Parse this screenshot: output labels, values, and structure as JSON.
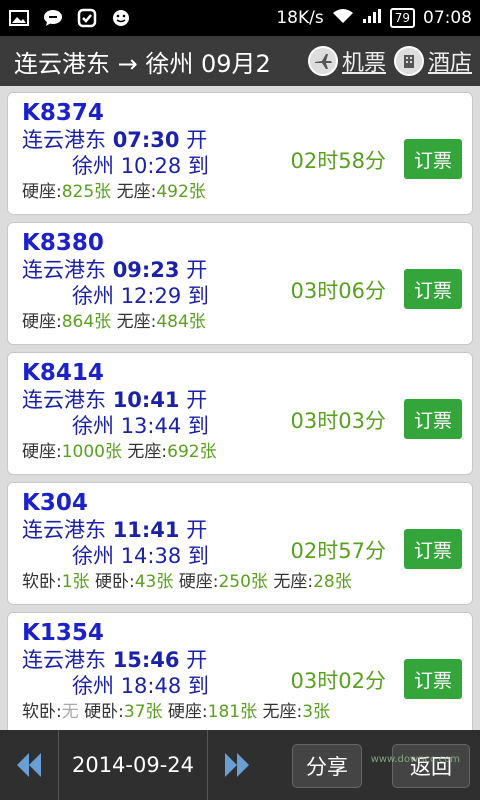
{
  "status_bar": {
    "speed": "18K/s",
    "battery": "79",
    "time": "07:08",
    "icons": [
      "image-icon",
      "chat-icon",
      "scan-icon",
      "smiley-icon",
      "wifi-icon",
      "signal-icon",
      "battery-icon"
    ]
  },
  "header": {
    "route": "连云港东 → 徐州 09月2",
    "flight_label": "机票",
    "hotel_label": "酒店"
  },
  "trains": [
    {
      "number": "K8374",
      "from_station": "连云港东",
      "depart_time": "07:30",
      "depart_suffix": "开",
      "to_station": "徐州",
      "arrive_time": "10:28",
      "arrive_suffix": "到",
      "duration": "02时58分",
      "book_label": "订票",
      "seats": [
        {
          "type": "硬座:",
          "count": "825张"
        },
        {
          "type": "无座:",
          "count": "492张"
        }
      ]
    },
    {
      "number": "K8380",
      "from_station": "连云港东",
      "depart_time": "09:23",
      "depart_suffix": "开",
      "to_station": "徐州",
      "arrive_time": "12:29",
      "arrive_suffix": "到",
      "duration": "03时06分",
      "book_label": "订票",
      "seats": [
        {
          "type": "硬座:",
          "count": "864张"
        },
        {
          "type": "无座:",
          "count": "484张"
        }
      ]
    },
    {
      "number": "K8414",
      "from_station": "连云港东",
      "depart_time": "10:41",
      "depart_suffix": "开",
      "to_station": "徐州",
      "arrive_time": "13:44",
      "arrive_suffix": "到",
      "duration": "03时03分",
      "book_label": "订票",
      "seats": [
        {
          "type": "硬座:",
          "count": "1000张"
        },
        {
          "type": "无座:",
          "count": "692张"
        }
      ]
    },
    {
      "number": "K304",
      "from_station": "连云港东",
      "depart_time": "11:41",
      "depart_suffix": "开",
      "to_station": "徐州",
      "arrive_time": "14:38",
      "arrive_suffix": "到",
      "duration": "02时57分",
      "book_label": "订票",
      "seats": [
        {
          "type": "软卧:",
          "count": "1张"
        },
        {
          "type": "硬卧:",
          "count": "43张"
        },
        {
          "type": "硬座:",
          "count": "250张"
        },
        {
          "type": "无座:",
          "count": "28张"
        }
      ]
    },
    {
      "number": "K1354",
      "from_station": "连云港东",
      "depart_time": "15:46",
      "depart_suffix": "开",
      "to_station": "徐州",
      "arrive_time": "18:48",
      "arrive_suffix": "到",
      "duration": "03时02分",
      "book_label": "订票",
      "seats": [
        {
          "type": "软卧:",
          "count": "无",
          "unavailable": true
        },
        {
          "type": "硬卧:",
          "count": "37张"
        },
        {
          "type": "硬座:",
          "count": "181张"
        },
        {
          "type": "无座:",
          "count": "3张"
        }
      ]
    }
  ],
  "footer": {
    "date": "2014-09-24",
    "share_label": "分享",
    "back_label": "返回",
    "watermark": "www.downcc.com"
  },
  "colors": {
    "train_number": "#1c22c8",
    "availability": "#5aa020",
    "book_button": "#34a53a"
  }
}
